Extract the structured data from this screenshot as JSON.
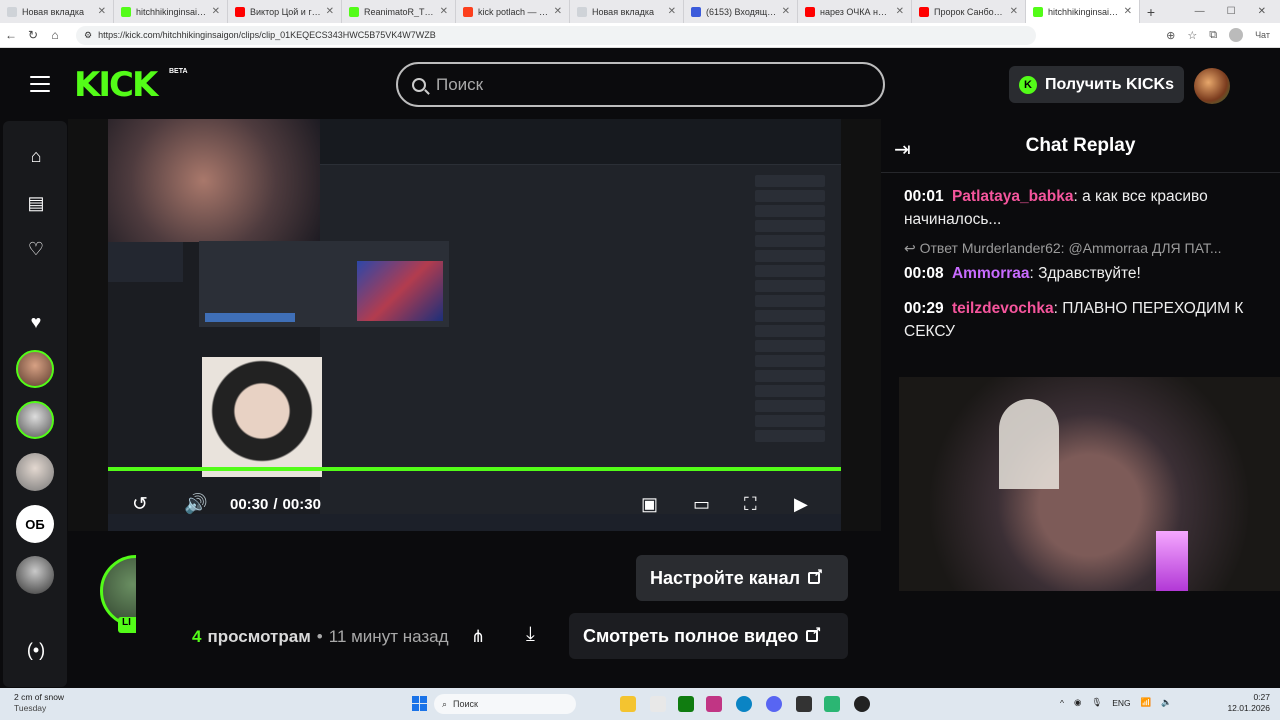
{
  "browser": {
    "tabs": [
      {
        "title": "Новая вкладка",
        "color": "#cfd3d8"
      },
      {
        "title": "hitchhikinginsaigon",
        "color": "#53fc18"
      },
      {
        "title": "Виктор Цой и груп",
        "color": "#ff0000"
      },
      {
        "title": "ReanimatoR_TV - V",
        "color": "#53fc18"
      },
      {
        "title": "kick potlach — Янд",
        "color": "#fc3f1d"
      },
      {
        "title": "Новая вкладка",
        "color": "#cfd3d8"
      },
      {
        "title": "(6153) Входящие -",
        "color": "#3b5bdb"
      },
      {
        "title": "нарез ОЧКА накла",
        "color": "#ff0000"
      },
      {
        "title": "Пророк Санбой(А",
        "color": "#ff0000"
      },
      {
        "title": "hitchhikinginsaigon",
        "color": "#53fc18"
      }
    ],
    "new_tab": "+",
    "url": "https://kick.com/hitchhikinginsaigon/clips/clip_01KEQECS343HWC5B75VK4W7WZB",
    "chat_label": "Чат"
  },
  "header": {
    "logo": "KICK",
    "beta": "BETA",
    "search_placeholder": "Поиск",
    "get_kicks": "Получить KICKs"
  },
  "player": {
    "time_current": "00:30",
    "time_sep": "/",
    "time_total": "00:30",
    "progress": 1.0
  },
  "clip": {
    "views": "4",
    "views_label": "просмотрам",
    "dot": "•",
    "ago": "11 минут назад",
    "setup_channel": "Настройте канал",
    "watch_full": "Смотреть полное видео",
    "live_tag": "LI"
  },
  "chat": {
    "title": "Chat Replay",
    "reply_to": "Ответ Murderlander62: @Ammorraa ДЛЯ ПАТ...",
    "messages": [
      {
        "time": "00:01",
        "user": "Patlataya_babka",
        "color": "#f5559c",
        "text": "а как все красиво начиналось..."
      },
      {
        "time": "00:08",
        "user": "Ammorraa",
        "color": "#c86bff",
        "text": "Здравствуйте!"
      },
      {
        "time": "00:29",
        "user": "teilzdevochka",
        "color": "#f5559c",
        "text": "ПЛАВНО ПЕРЕХОДИМ К СЕКСУ"
      }
    ]
  },
  "taskbar": {
    "weather_temp": "2 cm of snow",
    "weather_day": "Tuesday",
    "search": "Поиск",
    "lang": "ENG",
    "time": "0:27",
    "date": "12.01.2026"
  },
  "colors": {
    "accent": "#53fc18"
  }
}
